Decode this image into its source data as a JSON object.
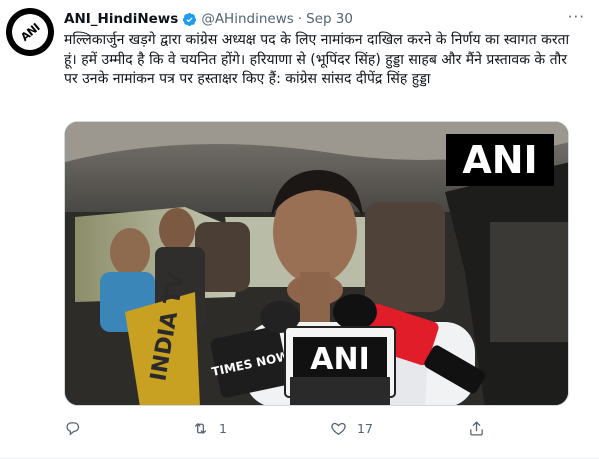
{
  "tweet": {
    "display_name": "ANI_HindiNews",
    "handle": "@AHindinews",
    "separator": "·",
    "date": "Sep 30",
    "text": "मल्लिकार्जुन खड़गे द्वारा कांग्रेस अध्यक्ष पद के लिए नामांकन दाखिल करने के निर्णय का स्वागत करता हूं। हमें उम्मीद है कि वे चयनित होंगे। हरियाणा से (भूपिंदर सिंह) हुड्डा साहब और मैंने प्रस्तावक के तौर पर उनके नामांकन पत्र पर हस्ताक्षर किए हैं: कांग्रेस सांसद दीपेंद्र सिंह हुड्डा",
    "avatar_logo_text": "ANI",
    "more_label": "···"
  },
  "media": {
    "watermark": "ANI",
    "mic_ani_label": "ANI",
    "mic_times_now_label": "TIMES NOW",
    "mic_india_tv_label": "INDIA TV"
  },
  "actions": {
    "reply_count": "",
    "retweet_count": "1",
    "like_count": "17",
    "share_count": ""
  },
  "icons": {
    "verified": "verified-badge-icon",
    "reply": "reply-icon",
    "retweet": "retweet-icon",
    "like": "heart-icon",
    "share": "share-icon",
    "more": "more-options-icon"
  },
  "colors": {
    "verified_blue": "#1d9bf0",
    "secondary_text": "#536471",
    "primary_text": "#0f1419"
  }
}
